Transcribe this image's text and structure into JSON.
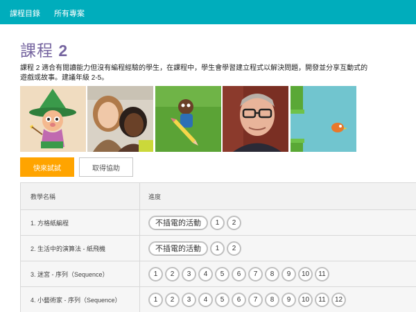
{
  "nav": {
    "course_catalog": "課程目錄",
    "all_projects": "所有專案"
  },
  "header": {
    "title_word": "課程",
    "title_number": "2"
  },
  "description": "課程 2 適合有閱讀能力但沒有編程經驗的學生，在課程中，學生會學習建立程式以解決問題，開發並分享互動式的遊戲或故事。建議年級 2-5。",
  "thumbnails": [
    "wizard-character",
    "two-girls-photo",
    "pencil-character",
    "man-with-glasses-photo",
    "flappy-bird-game"
  ],
  "buttons": {
    "try_now": "快來試試",
    "get_help": "取得協助"
  },
  "table": {
    "header_name": "教學名稱",
    "header_progress": "進度",
    "rows": [
      {
        "name": "1. 方格紙編程",
        "unplugged": "不插電的活動",
        "levels": [
          "1",
          "2"
        ]
      },
      {
        "name": "2. 生活中的演算法 - 紙飛機",
        "unplugged": "不插電的活動",
        "levels": [
          "1",
          "2"
        ]
      },
      {
        "name": "3. 迷宮 - 序列（Sequence）",
        "unplugged": "",
        "levels": [
          "1",
          "2",
          "3",
          "4",
          "5",
          "6",
          "7",
          "8",
          "9",
          "10",
          "11"
        ]
      },
      {
        "name": "4. 小藝術家 - 序列（Sequence）",
        "unplugged": "",
        "levels": [
          "1",
          "2",
          "3",
          "4",
          "5",
          "6",
          "7",
          "8",
          "9",
          "10",
          "11",
          "12"
        ]
      }
    ]
  },
  "colors": {
    "nav_bar": "#00adbc",
    "title": "#7665a0",
    "primary_button": "#ffa400"
  }
}
